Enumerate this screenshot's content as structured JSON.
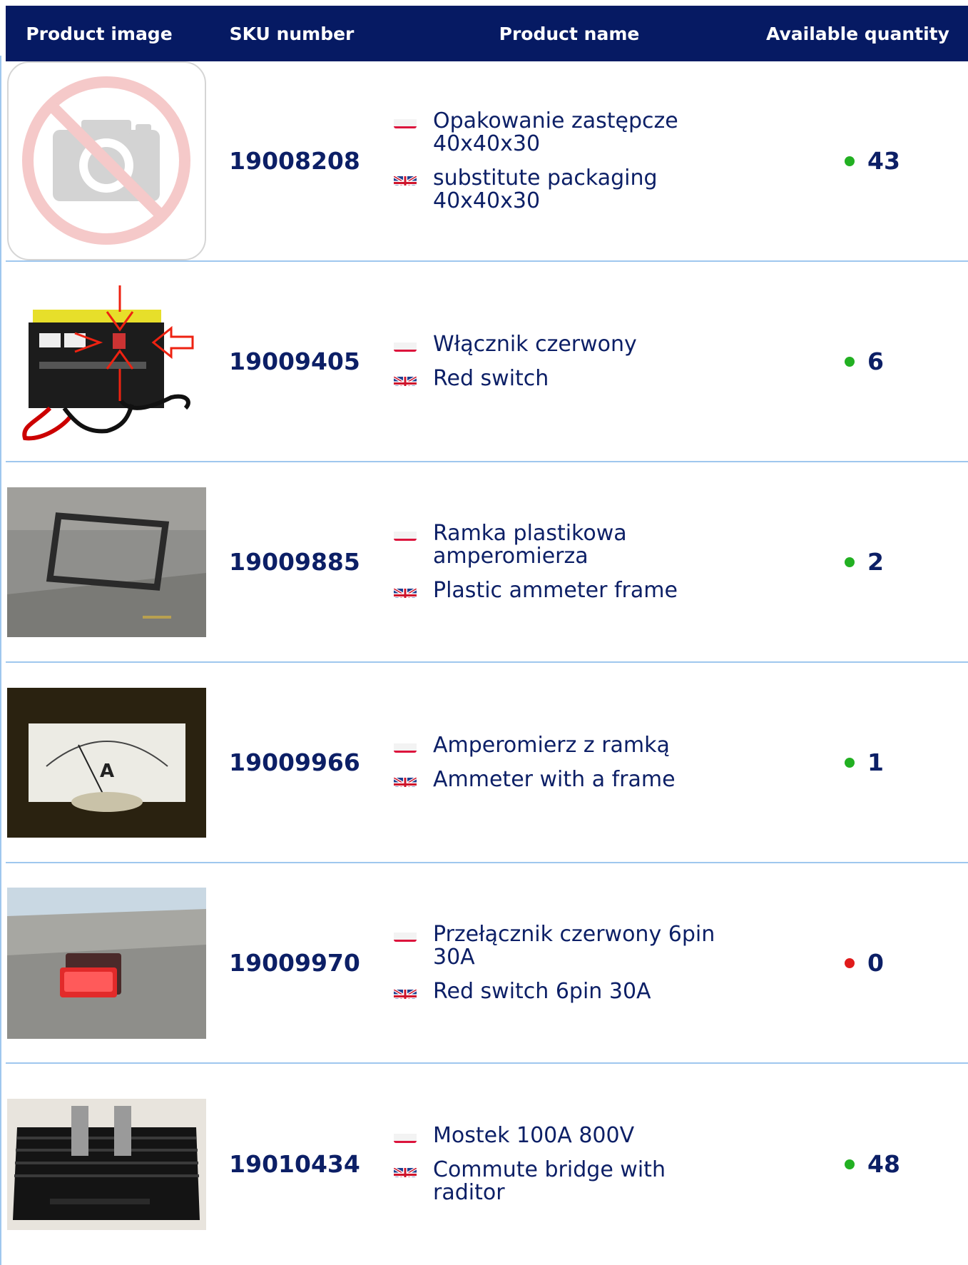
{
  "header": {
    "col_image": "Product image",
    "col_sku": "SKU number",
    "col_name": "Product name",
    "col_qty": "Available quantity"
  },
  "colors": {
    "header_bg": "#061a63",
    "text": "#0c1f66",
    "in_stock": "#22b022",
    "out_of_stock": "#e01b1b",
    "row_divider": "#9fc7ee"
  },
  "rows": [
    {
      "image": "no-photo-icon",
      "sku": "19008208",
      "name_pl": "Opakowanie zastępcze 40x40x30",
      "name_en": "substitute packaging 40x40x30",
      "qty": "43",
      "status": "in-stock"
    },
    {
      "image": "battery-charger-photo",
      "sku": "19009405",
      "name_pl": "Włącznik czerwony",
      "name_en": "Red switch",
      "qty": "6",
      "status": "in-stock"
    },
    {
      "image": "ammeter-frame-photo",
      "sku": "19009885",
      "name_pl": "Ramka plastikowa amperomierza",
      "name_en": "Plastic ammeter frame",
      "qty": "2",
      "status": "in-stock"
    },
    {
      "image": "ammeter-photo",
      "sku": "19009966",
      "name_pl": "Amperomierz z ramką",
      "name_en": "Ammeter with a frame",
      "qty": "1",
      "status": "in-stock"
    },
    {
      "image": "red-switch-photo",
      "sku": "19009970",
      "name_pl": "Przełącznik czerwony 6pin 30A",
      "name_en": "Red switch 6pin 30A",
      "qty": "0",
      "status": "out-of-stock"
    },
    {
      "image": "bridge-rectifier-photo",
      "sku": "19010434",
      "name_pl": "Mostek 100A 800V",
      "name_en": "Commute bridge with raditor",
      "qty": "48",
      "status": "in-stock"
    }
  ]
}
